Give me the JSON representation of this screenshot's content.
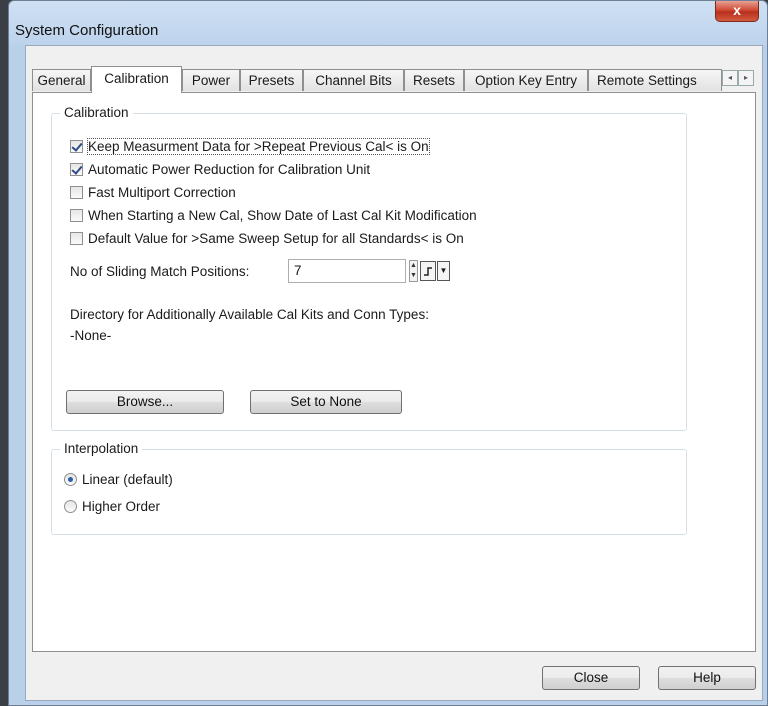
{
  "window": {
    "title": "System Configuration",
    "close_glyph": "x"
  },
  "tabs": [
    {
      "label": "General"
    },
    {
      "label": "Calibration"
    },
    {
      "label": "Power"
    },
    {
      "label": "Presets"
    },
    {
      "label": "Channel Bits"
    },
    {
      "label": "Resets"
    },
    {
      "label": "Option Key Entry"
    },
    {
      "label": "Remote Settings"
    }
  ],
  "tab_scroll": {
    "left": "◂",
    "right": "▸"
  },
  "calibration": {
    "group_title": "Calibration",
    "options": [
      {
        "label": "Keep Measurment Data for >Repeat Previous Cal< is On",
        "checked": true
      },
      {
        "label": "Automatic Power Reduction for Calibration Unit",
        "checked": true
      },
      {
        "label": "Fast Multiport Correction",
        "checked": false
      },
      {
        "label": "When Starting a New Cal, Show Date of Last Cal Kit Modification",
        "checked": false
      },
      {
        "label": "Default Value  for >Same Sweep Setup for all Standards< is On",
        "checked": false
      }
    ],
    "sliding_match_label": "No of Sliding Match Positions:",
    "sliding_match_value": "7",
    "directory_label": "Directory for Additionally Available Cal Kits and Conn Types:",
    "directory_value": "-None-",
    "browse_label": "Browse...",
    "set_none_label": "Set to None"
  },
  "interpolation": {
    "group_title": "Interpolation",
    "options": [
      {
        "label": "Linear (default)",
        "selected": true
      },
      {
        "label": "Higher Order",
        "selected": false
      }
    ]
  },
  "footer": {
    "close_label": "Close",
    "help_label": "Help"
  },
  "colors": {
    "title_bar": "#bdd3ec",
    "close_button": "#cf4b35",
    "radio_dot": "#2d5ea8",
    "check_mark": "#2d4b87"
  }
}
